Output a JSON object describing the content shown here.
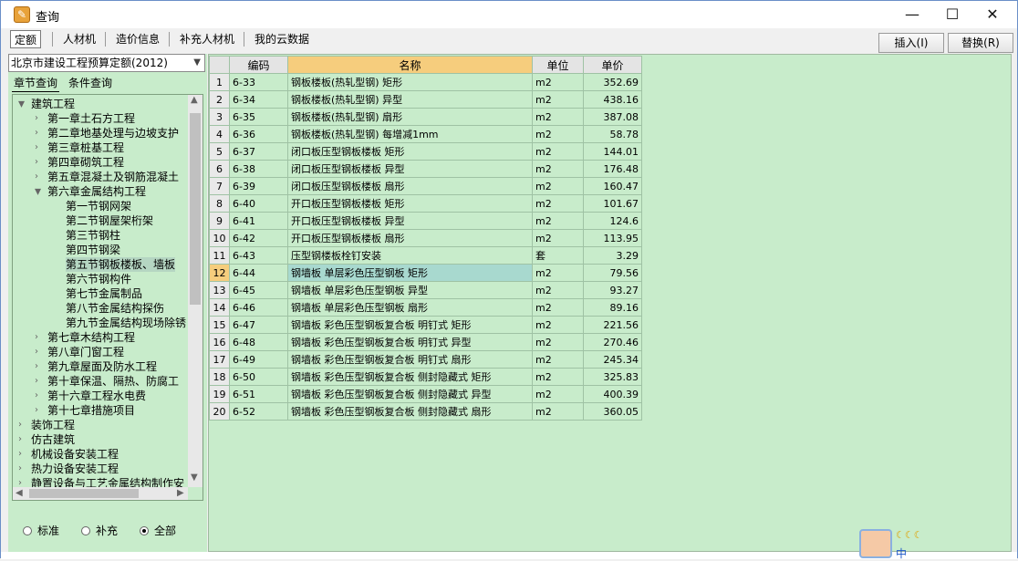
{
  "window": {
    "title": "查询",
    "min_icon": "minimize-icon",
    "max_icon": "maximize-icon",
    "close_icon": "close-icon"
  },
  "tabs": [
    "定额",
    "人材机",
    "造价信息",
    "补充人材机",
    "我的云数据"
  ],
  "actions": {
    "insert": "插入(I)",
    "replace": "替换(R)"
  },
  "left": {
    "dropdown": "北京市建设工程预算定额(2012)",
    "subtabs": [
      "章节查询",
      "条件查询"
    ],
    "tree": [
      {
        "label": "建筑工程",
        "level": 0,
        "expanded": true
      },
      {
        "label": "第一章土石方工程",
        "level": 1
      },
      {
        "label": "第二章地基处理与边坡支护",
        "level": 1
      },
      {
        "label": "第三章桩基工程",
        "level": 1
      },
      {
        "label": "第四章砌筑工程",
        "level": 1
      },
      {
        "label": "第五章混凝土及钢筋混凝土",
        "level": 1
      },
      {
        "label": "第六章金属结构工程",
        "level": 1,
        "expanded": true
      },
      {
        "label": "第一节钢网架",
        "level": 2
      },
      {
        "label": "第二节钢屋架桁架",
        "level": 2
      },
      {
        "label": "第三节钢柱",
        "level": 2
      },
      {
        "label": "第四节钢梁",
        "level": 2
      },
      {
        "label": "第五节钢板楼板、墙板",
        "level": 2,
        "selected": true
      },
      {
        "label": "第六节钢构件",
        "level": 2
      },
      {
        "label": "第七节金属制品",
        "level": 2
      },
      {
        "label": "第八节金属结构探伤",
        "level": 2
      },
      {
        "label": "第九节金属结构现场除锈",
        "level": 2
      },
      {
        "label": "第七章木结构工程",
        "level": 1
      },
      {
        "label": "第八章门窗工程",
        "level": 1
      },
      {
        "label": "第九章屋面及防水工程",
        "level": 1
      },
      {
        "label": "第十章保温、隔热、防腐工",
        "level": 1
      },
      {
        "label": "第十六章工程水电费",
        "level": 1
      },
      {
        "label": "第十七章措施项目",
        "level": 1
      },
      {
        "label": "装饰工程",
        "level": 0
      },
      {
        "label": "仿古建筑",
        "level": 0
      },
      {
        "label": "机械设备安装工程",
        "level": 0
      },
      {
        "label": "热力设备安装工程",
        "level": 0
      },
      {
        "label": "静置设备与工艺金属结构制作安",
        "level": 0
      },
      {
        "label": "电气设备安装工程",
        "level": 0
      }
    ],
    "radios": [
      {
        "label": "标准",
        "checked": false
      },
      {
        "label": "补充",
        "checked": false
      },
      {
        "label": "全部",
        "checked": true
      }
    ]
  },
  "table": {
    "headers": [
      "编码",
      "名称",
      "单位",
      "单价"
    ],
    "rows": [
      [
        "6-33",
        "钢板楼板(热轧型钢) 矩形",
        "m2",
        "352.69"
      ],
      [
        "6-34",
        "钢板楼板(热轧型钢) 异型",
        "m2",
        "438.16"
      ],
      [
        "6-35",
        "钢板楼板(热轧型钢) 扇形",
        "m2",
        "387.08"
      ],
      [
        "6-36",
        "钢板楼板(热轧型钢) 每增减1mm",
        "m2",
        "58.78"
      ],
      [
        "6-37",
        "闭口板压型钢板楼板 矩形",
        "m2",
        "144.01"
      ],
      [
        "6-38",
        "闭口板压型钢板楼板 异型",
        "m2",
        "176.48"
      ],
      [
        "6-39",
        "闭口板压型钢板楼板 扇形",
        "m2",
        "160.47"
      ],
      [
        "6-40",
        "开口板压型钢板楼板 矩形",
        "m2",
        "101.67"
      ],
      [
        "6-41",
        "开口板压型钢板楼板 异型",
        "m2",
        "124.6"
      ],
      [
        "6-42",
        "开口板压型钢板楼板 扇形",
        "m2",
        "113.95"
      ],
      [
        "6-43",
        "压型钢楼板栓钉安装",
        "套",
        "3.29"
      ],
      [
        "6-44",
        "钢墙板 单层彩色压型钢板 矩形",
        "m2",
        "79.56"
      ],
      [
        "6-45",
        "钢墙板 单层彩色压型钢板 异型",
        "m2",
        "93.27"
      ],
      [
        "6-46",
        "钢墙板 单层彩色压型钢板 扇形",
        "m2",
        "89.16"
      ],
      [
        "6-47",
        "钢墙板 彩色压型钢板复合板 明钉式 矩形",
        "m2",
        "221.56"
      ],
      [
        "6-48",
        "钢墙板 彩色压型钢板复合板 明钉式 异型",
        "m2",
        "270.46"
      ],
      [
        "6-49",
        "钢墙板 彩色压型钢板复合板 明钉式 扇形",
        "m2",
        "245.34"
      ],
      [
        "6-50",
        "钢墙板 彩色压型钢板复合板 侧封隐藏式 矩形",
        "m2",
        "325.83"
      ],
      [
        "6-51",
        "钢墙板 彩色压型钢板复合板 侧封隐藏式 异型",
        "m2",
        "400.39"
      ],
      [
        "6-52",
        "钢墙板 彩色压型钢板复合板 侧封隐藏式 扇形",
        "m2",
        "360.05"
      ]
    ],
    "selected_row": 12
  },
  "ime": {
    "moons": "☾☾☾",
    "label": "中"
  }
}
